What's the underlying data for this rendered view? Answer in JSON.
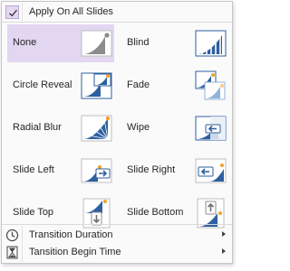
{
  "menu": {
    "apply_all": {
      "label": "Apply On All Slides",
      "checked": true
    },
    "effects": [
      {
        "label": "None",
        "icon": "none-transition-icon",
        "selected": true
      },
      {
        "label": "Blind",
        "icon": "blind-transition-icon",
        "selected": false
      },
      {
        "label": "Circle Reveal",
        "icon": "circle-reveal-transition-icon",
        "selected": false
      },
      {
        "label": "Fade",
        "icon": "fade-transition-icon",
        "selected": false
      },
      {
        "label": "Radial Blur",
        "icon": "radial-blur-transition-icon",
        "selected": false
      },
      {
        "label": "Wipe",
        "icon": "wipe-transition-icon",
        "selected": false
      },
      {
        "label": "Slide Left",
        "icon": "slide-left-transition-icon",
        "selected": false
      },
      {
        "label": "Slide Right",
        "icon": "slide-right-transition-icon",
        "selected": false
      },
      {
        "label": "Slide Top",
        "icon": "slide-top-transition-icon",
        "selected": false
      },
      {
        "label": "Slide Bottom",
        "icon": "slide-bottom-transition-icon",
        "selected": false
      }
    ],
    "duration": {
      "label": "Transition Duration",
      "icon": "clock-icon"
    },
    "begin_time": {
      "label": "Tansition Begin Time",
      "icon": "hourglass-icon"
    }
  },
  "colors": {
    "accent": "#e3d6f1",
    "icon_blue": "#2e5f9e",
    "icon_gray": "#8c8c8c",
    "icon_orange": "#f0a030"
  }
}
